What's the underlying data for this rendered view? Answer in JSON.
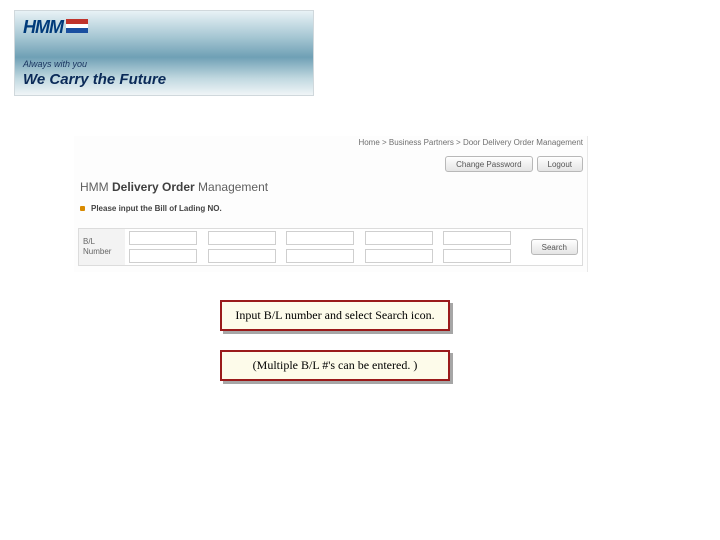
{
  "banner": {
    "brand": "HMM",
    "tagline_small": "Always with you",
    "tagline_big": "We Carry the Future"
  },
  "breadcrumb": {
    "item1": "Home",
    "sep1": " > ",
    "item2": "Business Partners",
    "sep2": " > ",
    "item3": "Door Delivery Order Management"
  },
  "buttons": {
    "change_password": "Change Password",
    "logout": "Logout",
    "search": "Search"
  },
  "page": {
    "title_prefix": "HMM ",
    "title_bold": "Delivery Order",
    "title_suffix": " Management",
    "instruction": "Please input the Bill of Lading NO."
  },
  "table": {
    "bl_label": "B/L Number"
  },
  "callout": {
    "line1": "Input B/L number and select Search icon.",
    "line2": "(Multiple B/L #'s can be entered. )"
  }
}
